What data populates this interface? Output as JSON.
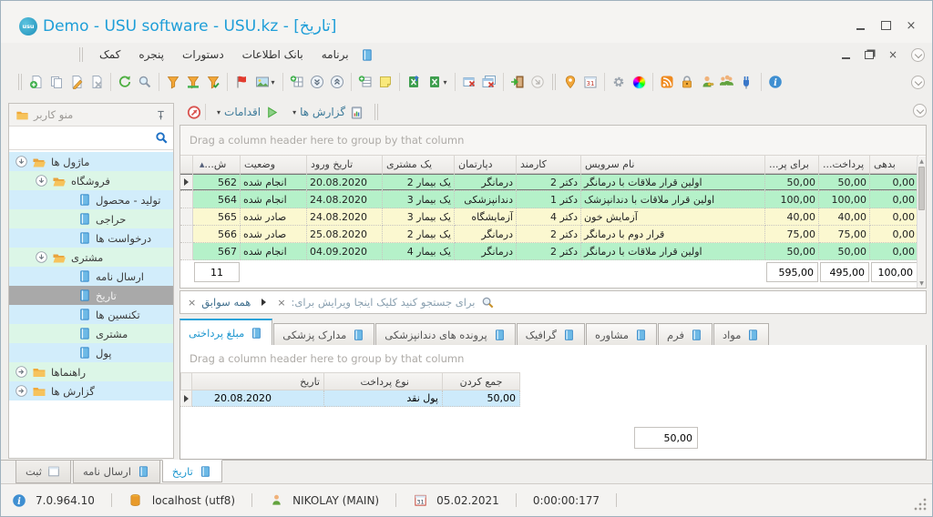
{
  "window": {
    "title": "Demo - USU software - USU.kz - [تاریخ]",
    "logo_text": "usu"
  },
  "menu": {
    "items": [
      {
        "label": "برنامه"
      },
      {
        "label": "بانک اطلاعات"
      },
      {
        "label": "دستورات"
      },
      {
        "label": "پنجره"
      },
      {
        "label": "کمک"
      }
    ]
  },
  "toolbar": {
    "icons": [
      "add-record",
      "copy-record",
      "edit-record",
      "delete-record",
      "refresh",
      "search",
      "filter",
      "filter-applied",
      "filter-check",
      "flag",
      "image-menu",
      "add-column",
      "collapse-all",
      "expand-all",
      "add-row",
      "note",
      "excel-export",
      "excel-import-menu",
      "close-window",
      "close-all-windows",
      "exit",
      "linked-record",
      "location",
      "calendar",
      "settings",
      "color-scheme",
      "rss",
      "lock",
      "user-permissions",
      "user-groups",
      "plugin",
      "info"
    ]
  },
  "actions_bar": {
    "actions_label": "اقدامات",
    "reports_label": "گزارش ها"
  },
  "sidebar": {
    "title": "منو کاربر",
    "search_placeholder": "",
    "items": [
      {
        "label": "ماژول ها"
      },
      {
        "label": "فروشگاه"
      },
      {
        "label": "تولید - محصول"
      },
      {
        "label": "حراجی"
      },
      {
        "label": "درخواست ها"
      },
      {
        "label": "مشتری"
      },
      {
        "label": "ارسال نامه"
      },
      {
        "label": "تاریخ"
      },
      {
        "label": "تکنسین ها"
      },
      {
        "label": "مشتری"
      },
      {
        "label": "پول"
      },
      {
        "label": "راهنماها"
      },
      {
        "label": "گزارش ها"
      }
    ]
  },
  "grid": {
    "group_hint": "Drag a column header here to group by that column",
    "columns": [
      {
        "label": "ش..."
      },
      {
        "label": "وضعیت"
      },
      {
        "label": "تاریخ ورود"
      },
      {
        "label": "یک مشتری"
      },
      {
        "label": "دپارتمان"
      },
      {
        "label": "کارمند"
      },
      {
        "label": "نام سرویس"
      },
      {
        "label": "برای پر..."
      },
      {
        "label": "پرداخت..."
      },
      {
        "label": "بدهی"
      }
    ],
    "rows": [
      {
        "id": "562",
        "status": "انجام شده",
        "entry_date": "20.08.2020",
        "customer": "یک بیمار 2",
        "department": "درمانگر",
        "employee": "دکتر 2",
        "service": "اولین قرار ملاقات با درمانگر",
        "for_pay": "50,00",
        "paid": "50,00",
        "debt": "0,00"
      },
      {
        "id": "564",
        "status": "انجام شده",
        "entry_date": "24.08.2020",
        "customer": "یک بیمار 3",
        "department": "دندانپزشکی",
        "employee": "دکتر 1",
        "service": "اولین قرار ملاقات با دندانپزشک",
        "for_pay": "100,00",
        "paid": "100,00",
        "debt": "0,00"
      },
      {
        "id": "565",
        "status": "صادر شده",
        "entry_date": "24.08.2020",
        "customer": "یک بیمار 3",
        "department": "آزمایشگاه",
        "employee": "دکتر 4",
        "service": "آزمایش خون",
        "for_pay": "40,00",
        "paid": "40,00",
        "debt": "0,00"
      },
      {
        "id": "566",
        "status": "صادر شده",
        "entry_date": "25.08.2020",
        "customer": "یک بیمار 2",
        "department": "درمانگر",
        "employee": "دکتر 2",
        "service": "قرار دوم با درمانگر",
        "for_pay": "75,00",
        "paid": "75,00",
        "debt": "0,00"
      },
      {
        "id": "567",
        "status": "انجام شده",
        "entry_date": "04.09.2020",
        "customer": "یک بیمار 4",
        "department": "درمانگر",
        "employee": "دکتر 2",
        "service": "اولین قرار ملاقات با درمانگر",
        "for_pay": "50,00",
        "paid": "50,00",
        "debt": "0,00"
      }
    ],
    "count": "11",
    "totals": {
      "for_pay": "595,00",
      "paid": "495,00",
      "debt": "100,00"
    }
  },
  "filter_bar": {
    "scope": "همه سوابق",
    "hint": "برای جستجو کنید کلیک اینجا ویرایش برای:"
  },
  "detail_tabs": [
    {
      "label": "مبلغ پرداختی"
    },
    {
      "label": "مدارک پزشکی"
    },
    {
      "label": "پرونده های دندانپزشکی"
    },
    {
      "label": "گرافیک"
    },
    {
      "label": "مشاوره"
    },
    {
      "label": "فرم"
    },
    {
      "label": "مواد"
    }
  ],
  "subgrid": {
    "group_hint": "Drag a column header here to group by that column",
    "columns": [
      {
        "label": "تاریخ"
      },
      {
        "label": "نوع پرداخت"
      },
      {
        "label": "جمع کردن"
      }
    ],
    "row": {
      "date": "20.08.2020",
      "type": "پول نقد",
      "sum": "50,00"
    },
    "total": "50,00"
  },
  "bottom_tabs": [
    {
      "label": "ثبت"
    },
    {
      "label": "ارسال نامه"
    },
    {
      "label": "تاریخ"
    }
  ],
  "status_bar": {
    "version": "7.0.964.10",
    "database": "localhost (utf8)",
    "user": "NIKOLAY (MAIN)",
    "date": "05.02.2021",
    "timer": "0:00:00:177"
  }
}
